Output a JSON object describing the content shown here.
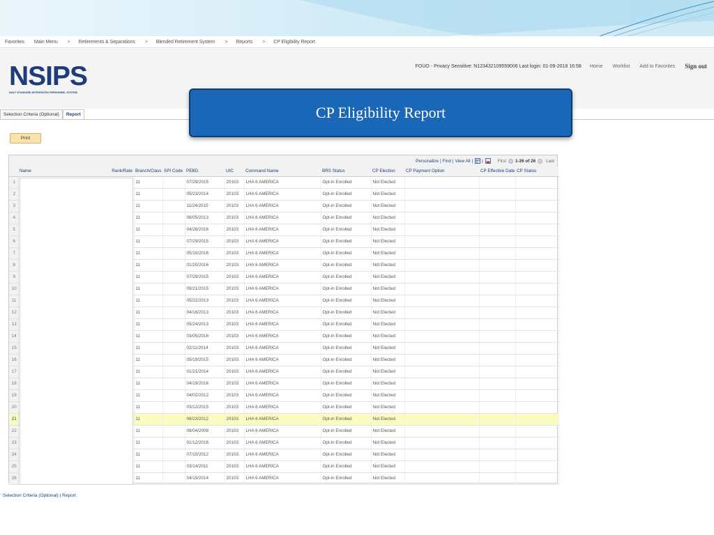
{
  "breadcrumb": [
    "Favorites",
    "Main Menu",
    "Retirements & Separations",
    "Blended Retirement System",
    "Reports",
    "CP Eligibility Report"
  ],
  "breadcrumb_separator": ">",
  "logo": {
    "word": "NSIPS",
    "tagline": "NAVY STANDARD INTEGRATED PERSONNEL SYSTEM"
  },
  "header": {
    "fouo": "FOUO - Privacy Sensitive: N123432109559006 Last login: 01-09-2018 16:58",
    "links": [
      "Home",
      "Worklist",
      "Add to Favorites"
    ],
    "sign_out": "Sign out"
  },
  "tabs": [
    {
      "label": "Selection Criteria (Optional)",
      "active": false
    },
    {
      "label": "Report",
      "active": true
    }
  ],
  "title_box": "CP Eligibility Report",
  "print_label": "Print",
  "grid": {
    "toolbar": {
      "personalize": "Personalize",
      "find": "Find",
      "view_all": "View All",
      "first": "First",
      "range": "1-26 of 26",
      "last": "Last"
    },
    "columns": [
      "Name",
      "Rank/Rate",
      "Branch/Class",
      "SPI Code",
      "PEBD",
      "UIC",
      "Command Name",
      "BRS Status",
      "CP Election",
      "CP Payment Option",
      "CP Effective Date",
      "CP Status"
    ],
    "highlight_row": 21,
    "rows": [
      {
        "n": "1",
        "branch": "11",
        "pebd": "07/29/2015",
        "uic": "20103",
        "cmd": "LHA 6 AMERICA",
        "brs": "Opt-in Enrolled",
        "cp": "Not Elected"
      },
      {
        "n": "2",
        "branch": "11",
        "pebd": "05/23/2014",
        "uic": "20103",
        "cmd": "LHA 6 AMERICA",
        "brs": "Opt-in Enrolled",
        "cp": "Not Elected"
      },
      {
        "n": "3",
        "branch": "11",
        "pebd": "11/24/2015",
        "uic": "20103",
        "cmd": "LHA 6 AMERICA",
        "brs": "Opt-in Enrolled",
        "cp": "Not Elected"
      },
      {
        "n": "4",
        "branch": "11",
        "pebd": "08/05/2013",
        "uic": "20103",
        "cmd": "LHA 6 AMERICA",
        "brs": "Opt-in Enrolled",
        "cp": "Not Elected"
      },
      {
        "n": "5",
        "branch": "11",
        "pebd": "04/28/2016",
        "uic": "20103",
        "cmd": "LHA 6 AMERICA",
        "brs": "Opt-in Enrolled",
        "cp": "Not Elected"
      },
      {
        "n": "6",
        "branch": "11",
        "pebd": "07/29/2015",
        "uic": "20103",
        "cmd": "LHA 6 AMERICA",
        "brs": "Opt-in Enrolled",
        "cp": "Not Elected"
      },
      {
        "n": "7",
        "branch": "11",
        "pebd": "05/10/2016",
        "uic": "20103",
        "cmd": "LHA 6 AMERICA",
        "brs": "Opt-in Enrolled",
        "cp": "Not Elected"
      },
      {
        "n": "8",
        "branch": "11",
        "pebd": "01/20/2016",
        "uic": "20103",
        "cmd": "LHA 6 AMERICA",
        "brs": "Opt-in Enrolled",
        "cp": "Not Elected"
      },
      {
        "n": "9",
        "branch": "11",
        "pebd": "07/29/2015",
        "uic": "20103",
        "cmd": "LHA 6 AMERICA",
        "brs": "Opt-in Enrolled",
        "cp": "Not Elected"
      },
      {
        "n": "10",
        "branch": "11",
        "pebd": "09/21/2015",
        "uic": "20103",
        "cmd": "LHA 6 AMERICA",
        "brs": "Opt-in Enrolled",
        "cp": "Not Elected"
      },
      {
        "n": "11",
        "branch": "11",
        "pebd": "05/22/2013",
        "uic": "20103",
        "cmd": "LHA 6 AMERICA",
        "brs": "Opt-in Enrolled",
        "cp": "Not Elected"
      },
      {
        "n": "12",
        "branch": "11",
        "pebd": "04/16/2013",
        "uic": "20103",
        "cmd": "LHA 6 AMERICA",
        "brs": "Opt-in Enrolled",
        "cp": "Not Elected"
      },
      {
        "n": "13",
        "branch": "11",
        "pebd": "05/24/2013",
        "uic": "20103",
        "cmd": "LHA 6 AMERICA",
        "brs": "Opt-in Enrolled",
        "cp": "Not Elected"
      },
      {
        "n": "14",
        "branch": "11",
        "pebd": "03/05/2016",
        "uic": "20103",
        "cmd": "LHA 6 AMERICA",
        "brs": "Opt-in Enrolled",
        "cp": "Not Elected"
      },
      {
        "n": "15",
        "branch": "11",
        "pebd": "02/11/2014",
        "uic": "20103",
        "cmd": "LHA 6 AMERICA",
        "brs": "Opt-in Enrolled",
        "cp": "Not Elected"
      },
      {
        "n": "16",
        "branch": "11",
        "pebd": "05/19/2015",
        "uic": "20103",
        "cmd": "LHA 6 AMERICA",
        "brs": "Opt-in Enrolled",
        "cp": "Not Elected"
      },
      {
        "n": "17",
        "branch": "11",
        "pebd": "01/21/2014",
        "uic": "20103",
        "cmd": "LHA 6 AMERICA",
        "brs": "Opt-in Enrolled",
        "cp": "Not Elected"
      },
      {
        "n": "18",
        "branch": "11",
        "pebd": "04/19/2016",
        "uic": "20103",
        "cmd": "LHA 6 AMERICA",
        "brs": "Opt-in Enrolled",
        "cp": "Not Elected"
      },
      {
        "n": "19",
        "branch": "11",
        "pebd": "04/02/2012",
        "uic": "20103",
        "cmd": "LHA 6 AMERICA",
        "brs": "Opt-in Enrolled",
        "cp": "Not Elected"
      },
      {
        "n": "20",
        "branch": "11",
        "pebd": "03/12/2015",
        "uic": "20103",
        "cmd": "LHA 6 AMERICA",
        "brs": "Opt-in Enrolled",
        "cp": "Not Elected"
      },
      {
        "n": "21",
        "branch": "11",
        "pebd": "08/23/2012",
        "uic": "20103",
        "cmd": "LHA 6 AMERICA",
        "brs": "Opt-in Enrolled",
        "cp": "Not Elected"
      },
      {
        "n": "22",
        "branch": "11",
        "pebd": "08/04/2008",
        "uic": "20103",
        "cmd": "LHA 6 AMERICA",
        "brs": "Opt-in Enrolled",
        "cp": "Not Elected"
      },
      {
        "n": "23",
        "branch": "11",
        "pebd": "01/12/2016",
        "uic": "20103",
        "cmd": "LHA 6 AMERICA",
        "brs": "Opt-in Enrolled",
        "cp": "Not Elected"
      },
      {
        "n": "24",
        "branch": "11",
        "pebd": "07/10/2012",
        "uic": "20103",
        "cmd": "LHA 6 AMERICA",
        "brs": "Opt-in Enrolled",
        "cp": "Not Elected"
      },
      {
        "n": "25",
        "branch": "11",
        "pebd": "03/14/2011",
        "uic": "20103",
        "cmd": "LHA 6 AMERICA",
        "brs": "Opt-in Enrolled",
        "cp": "Not Elected"
      },
      {
        "n": "26",
        "branch": "11",
        "pebd": "04/15/2014",
        "uic": "20103",
        "cmd": "LHA 6 AMERICA",
        "brs": "Opt-in Enrolled",
        "cp": "Not Elected"
      }
    ]
  },
  "bottom_links": {
    "selection": "Selection Criteria (Optional)",
    "separator": "|",
    "report": "Report"
  },
  "colors": {
    "title_box": "#1a67b7",
    "logo": "#1f3c7a",
    "highlight_row": "#fcfcc0",
    "print_button": "#fbe3ad"
  }
}
